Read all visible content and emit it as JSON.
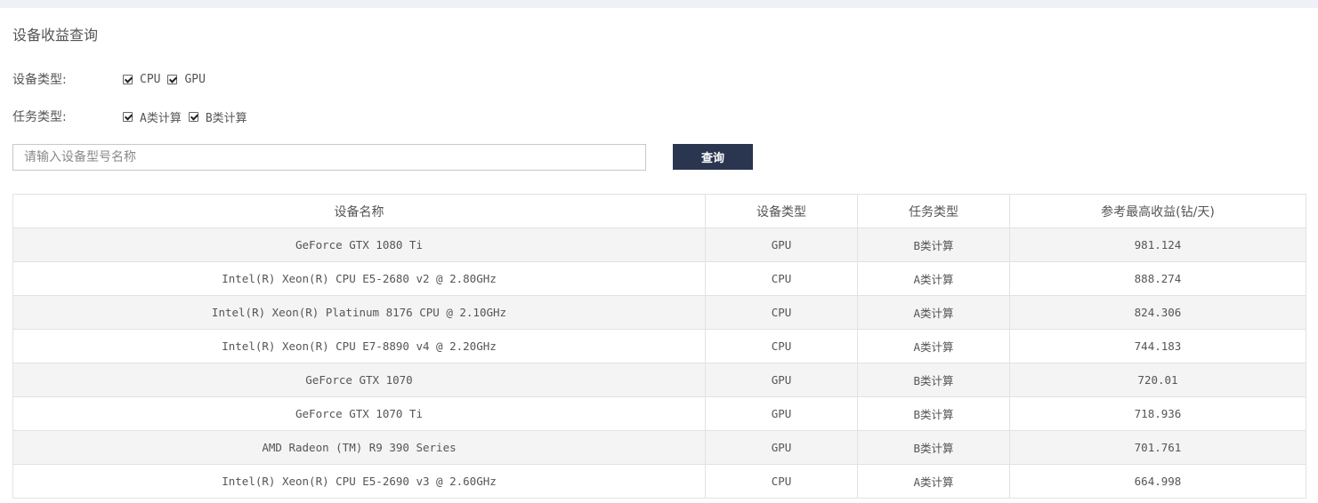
{
  "page": {
    "title": "设备收益查询"
  },
  "filters": {
    "device_type": {
      "label": "设备类型:",
      "options": [
        {
          "label": "CPU",
          "checked": true
        },
        {
          "label": "GPU",
          "checked": true
        }
      ]
    },
    "task_type": {
      "label": "任务类型:",
      "options": [
        {
          "label": "A类计算",
          "checked": true
        },
        {
          "label": "B类计算",
          "checked": true
        }
      ]
    }
  },
  "search": {
    "placeholder": "请输入设备型号名称",
    "value": "",
    "button_label": "查询"
  },
  "table": {
    "headers": [
      "设备名称",
      "设备类型",
      "任务类型",
      "参考最高收益(钻/天)"
    ],
    "rows": [
      [
        "GeForce GTX 1080 Ti",
        "GPU",
        "B类计算",
        "981.124"
      ],
      [
        "Intel(R) Xeon(R) CPU E5-2680 v2 @ 2.80GHz",
        "CPU",
        "A类计算",
        "888.274"
      ],
      [
        "Intel(R) Xeon(R) Platinum 8176 CPU @ 2.10GHz",
        "CPU",
        "A类计算",
        "824.306"
      ],
      [
        "Intel(R) Xeon(R) CPU E7-8890 v4 @ 2.20GHz",
        "CPU",
        "A类计算",
        "744.183"
      ],
      [
        "GeForce GTX 1070",
        "GPU",
        "B类计算",
        "720.01"
      ],
      [
        "GeForce GTX 1070 Ti",
        "GPU",
        "B类计算",
        "718.936"
      ],
      [
        "AMD Radeon (TM) R9 390 Series",
        "GPU",
        "B类计算",
        "701.761"
      ],
      [
        "Intel(R) Xeon(R) CPU E5-2690 v3 @ 2.60GHz",
        "CPU",
        "A类计算",
        "664.998"
      ]
    ]
  }
}
